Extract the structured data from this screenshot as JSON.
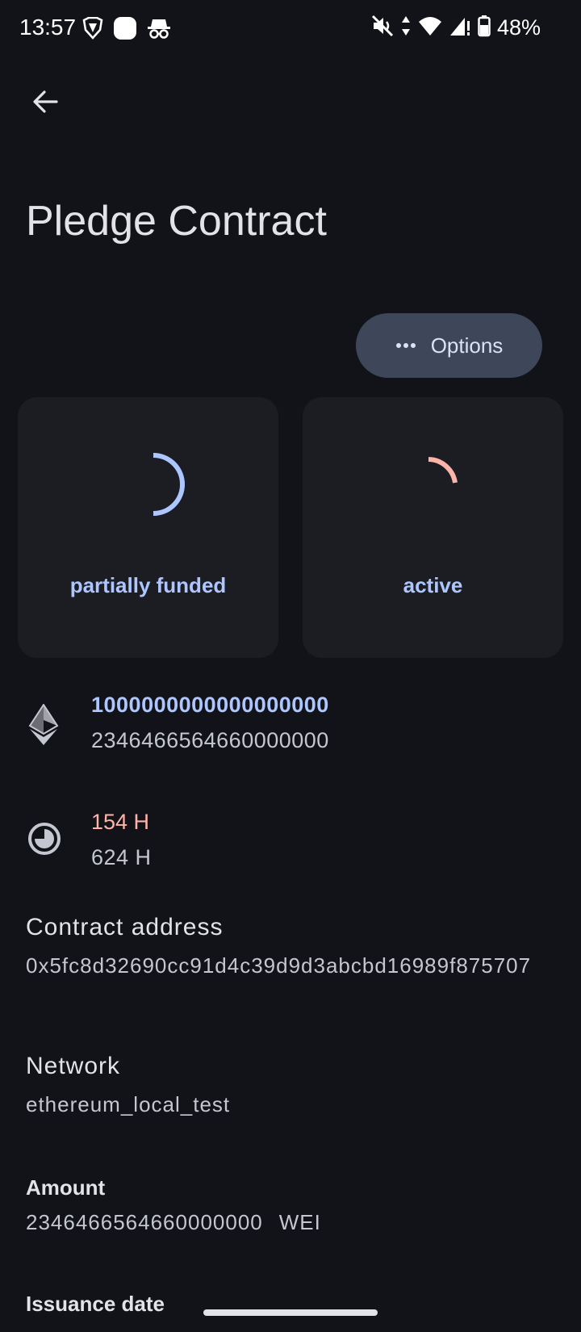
{
  "status_bar": {
    "time": "13:57",
    "battery": "48%",
    "left_icons": [
      "brave-icon",
      "app-icon",
      "incognito-icon"
    ],
    "right_icons": [
      "mute-icon",
      "data-icon",
      "wifi-icon",
      "signal-icon",
      "battery-icon"
    ]
  },
  "header": {
    "back_icon": "arrow-left-icon",
    "title": "Pledge Contract"
  },
  "options_button": {
    "icon": "more-horiz-icon",
    "label": "Options"
  },
  "cards": {
    "funding": {
      "label": "partially funded",
      "spinner_color": "#aec6ff"
    },
    "state": {
      "label": "active",
      "spinner_color": "#ffb4a9"
    }
  },
  "funding_info": {
    "icon": "ethereum-icon",
    "target": "1000000000000000000",
    "current": "2346466564660000000"
  },
  "time_info": {
    "icon": "clock-icon",
    "remaining": "154 H",
    "total": "624 H"
  },
  "details": {
    "contract_address_label": "Contract address",
    "contract_address": "0x5fc8d32690cc91d4c39d9d3abcbd16989f875707",
    "network_label": "Network",
    "network": "ethereum_local_test",
    "amount_label": "Amount",
    "amount": "2346466564660000000",
    "amount_unit": "WEI",
    "issuance_date_label": "Issuance date"
  },
  "colors": {
    "background": "#121318",
    "card": "#1b1d23",
    "accent_blue": "#aec6ff",
    "accent_red": "#ffb4a9",
    "button": "#3e4759"
  }
}
